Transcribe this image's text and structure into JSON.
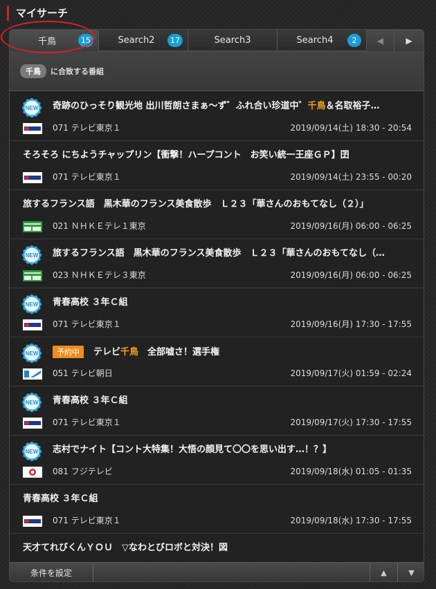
{
  "header": {
    "title": "マイサーチ"
  },
  "tabs": [
    {
      "label": "千鳥",
      "count": "15"
    },
    {
      "label": "Search2",
      "count": "17"
    },
    {
      "label": "Search3",
      "count": ""
    },
    {
      "label": "Search4",
      "count": "2"
    }
  ],
  "filter": {
    "keyword": "千鳥",
    "suffix": "に合致する番組"
  },
  "programs": [
    {
      "new": true,
      "title_pre": "奇跡のひっそり観光地 出川哲朗さまぁ～ず゛ふれ合い珍道中゛",
      "title_hl": "千鳥",
      "title_post": "＆名取裕子…",
      "logo": "tvtokyo",
      "channel": "071 テレビ東京１",
      "time": "2019/09/14(土) 18:30 - 20:54"
    },
    {
      "new": false,
      "title_pre": "そろそろ にちようチャップリン【衝撃！ハープコント　お笑い統一王座ＧＰ】囝",
      "title_hl": "",
      "title_post": "",
      "logo": "tvtokyo",
      "channel": "071 テレビ東京１",
      "time": "2019/09/14(土) 23:55 - 00:20"
    },
    {
      "new": false,
      "title_pre": "旅するフランス語　黒木華のフランス美食散歩　Ｌ２３「華さんのおもてなし（２）」",
      "title_hl": "",
      "title_post": "",
      "logo": "nhketele",
      "channel": "021 ＮＨＫＥテレ１東京",
      "time": "2019/09/16(月) 06:00 - 06:25"
    },
    {
      "new": true,
      "title_pre": "旅するフランス語　黒木華のフランス美食散歩　Ｌ２３「華さんのおもてなし（…",
      "title_hl": "",
      "title_post": "",
      "logo": "nhketele",
      "channel": "023 ＮＨＫＥテレ３東京",
      "time": "2019/09/16(月) 06:00 - 06:25"
    },
    {
      "new": true,
      "title_pre": "青春高校 ３年Ｃ組",
      "title_hl": "",
      "title_post": "",
      "logo": "tvtokyo",
      "channel": "071 テレビ東京１",
      "time": "2019/09/16(月) 17:30 - 17:55"
    },
    {
      "new": true,
      "reserved": "予約中",
      "title_pre": "テレビ",
      "title_hl": "千鳥",
      "title_post": "　全部嘘さ！選手権",
      "logo": "asahi",
      "channel": "051 テレビ朝日",
      "time": "2019/09/17(火) 01:59 - 02:24"
    },
    {
      "new": true,
      "title_pre": "青春高校 ３年Ｃ組",
      "title_hl": "",
      "title_post": "",
      "logo": "tvtokyo",
      "channel": "071 テレビ東京１",
      "time": "2019/09/17(火) 17:30 - 17:55"
    },
    {
      "new": true,
      "title_pre": "志村でナイト【コント大特集！大悟の顔見て〇〇を思い出す…！？】",
      "title_hl": "",
      "title_post": "",
      "logo": "fuji",
      "channel": "081 フジテレビ",
      "time": "2019/09/18(水) 01:05 - 01:35"
    },
    {
      "new": false,
      "title_pre": "青春高校 ３年Ｃ組",
      "title_hl": "",
      "title_post": "",
      "logo": "tvtokyo",
      "channel": "071 テレビ東京１",
      "time": "2019/09/18(水) 17:30 - 17:55"
    },
    {
      "new": false,
      "title_pre": "天才てれびくんＹＯＵ　▽なわとびロボと対決！図",
      "title_hl": "",
      "title_post": "",
      "logo": "",
      "channel": "",
      "time": ""
    }
  ],
  "footer": {
    "settings_label": "条件を設定",
    "up_icon": "▲",
    "down_icon": "▼"
  },
  "icons": {
    "new_badge": "NEW",
    "prev_icon": "◀",
    "next_icon": "▶"
  },
  "colors": {
    "accent_red": "#d42020",
    "badge_blue": "#1a9fd6",
    "highlight_orange": "#f0a01e",
    "reserved_orange": "#f08c1e"
  }
}
